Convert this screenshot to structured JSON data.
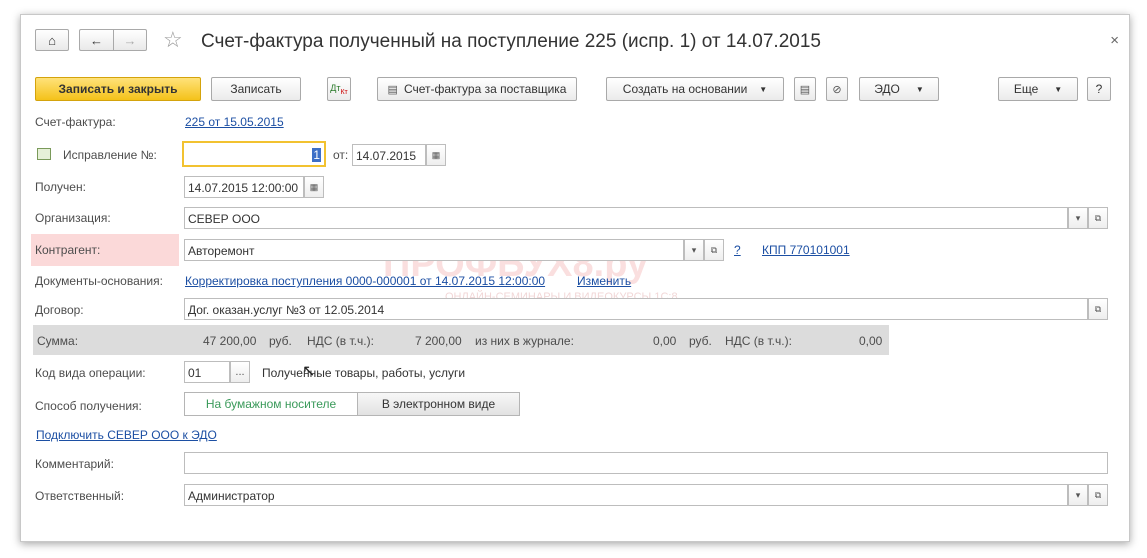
{
  "header": {
    "title": "Счет-фактура полученный на поступление 225 (испр. 1) от 14.07.2015",
    "home_icon": "⌂",
    "back_icon": "←",
    "forward_icon": "→",
    "star_icon": "☆",
    "close_icon": "×"
  },
  "toolbar": {
    "save_close": "Записать и закрыть",
    "save": "Записать",
    "invoice_supplier": "Счет-фактура за поставщика",
    "create_based": "Создать на основании",
    "edo": "ЭДО",
    "more": "Еще",
    "help": "?"
  },
  "form": {
    "invoice_label": "Счет-фактура:",
    "invoice_link": "225 от 15.05.2015",
    "correction_label": "Исправление №:",
    "correction_value": "1",
    "from_label": "от:",
    "correction_date": "14.07.2015",
    "received_label": "Получен:",
    "received_value": "14.07.2015 12:00:00",
    "org_label": "Организация:",
    "org_value": "СЕВЕР ООО",
    "contractor_label": "Контрагент:",
    "contractor_value": "Авторемонт",
    "contractor_q": "?",
    "kpp_link": "КПП 770101001",
    "docs_label": "Документы-основания:",
    "docs_link": "Корректировка поступления 0000-000001 от 14.07.2015 12:00:00",
    "docs_change": "Изменить",
    "contract_label": "Договор:",
    "contract_value": "Дог. оказан.услуг №3 от 12.05.2014",
    "sum_label": "Сумма:",
    "sum_value": "47 200,00",
    "rub1": "руб.",
    "vat_label": "НДС (в т.ч.):",
    "vat_value": "7 200,00",
    "journal_label": "из них в журнале:",
    "journal_value": "0,00",
    "rub2": "руб.",
    "vat_label2": "НДС (в т.ч.):",
    "vat_value2": "0,00",
    "opcode_label": "Код вида операции:",
    "opcode_value": "01",
    "opcode_desc": "Полученные товары, работы, услуги",
    "method_label": "Способ получения:",
    "method_paper": "На бумажном носителе",
    "method_electronic": "В электронном виде",
    "connect_link": "Подключить СЕВЕР ООО к ЭДО",
    "comment_label": "Комментарий:",
    "comment_value": "",
    "responsible_label": "Ответственный:",
    "responsible_value": "Администратор"
  },
  "watermark": {
    "main": "ПРОФБУХ8.ру",
    "sub": "ОНЛАЙН-СЕМИНАРЫ И ВИДЕОКУРСЫ 1С:8"
  },
  "colors": {
    "primary_button": "#f4c21a",
    "link": "#1c4fa3",
    "highlight_row": "#fbd9d9"
  }
}
